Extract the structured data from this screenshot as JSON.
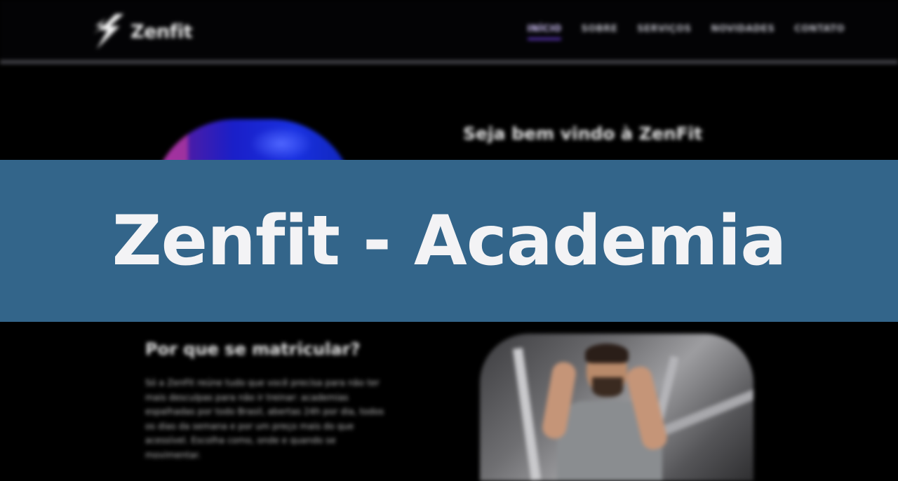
{
  "header": {
    "brand": "Zenfit",
    "nav": [
      {
        "label": "INÍCIO",
        "active": true
      },
      {
        "label": "SOBRE",
        "active": false
      },
      {
        "label": "SERVIÇOS",
        "active": false
      },
      {
        "label": "NOVIDADES",
        "active": false
      },
      {
        "label": "CONTATO",
        "active": false
      }
    ],
    "accent_color": "#6b3fd6"
  },
  "hero": {
    "welcome_title": "Seja bem vindo à ZenFit"
  },
  "why": {
    "title": "Por que se matricular?",
    "text": "Só a ZenFit reúne tudo que você precisa para não ter mais desculpas para não ir treinar: academias espalhadas por todo Brasil, abertas 24h por dia, todos os dias da semana e por um preço mais do que acessível. Escolha como, onde e quando se movimentar."
  },
  "banner": {
    "title": "Zenfit - Academia",
    "background": "#33658a"
  },
  "icons": {
    "logo": "lightning-bolt-icon"
  }
}
